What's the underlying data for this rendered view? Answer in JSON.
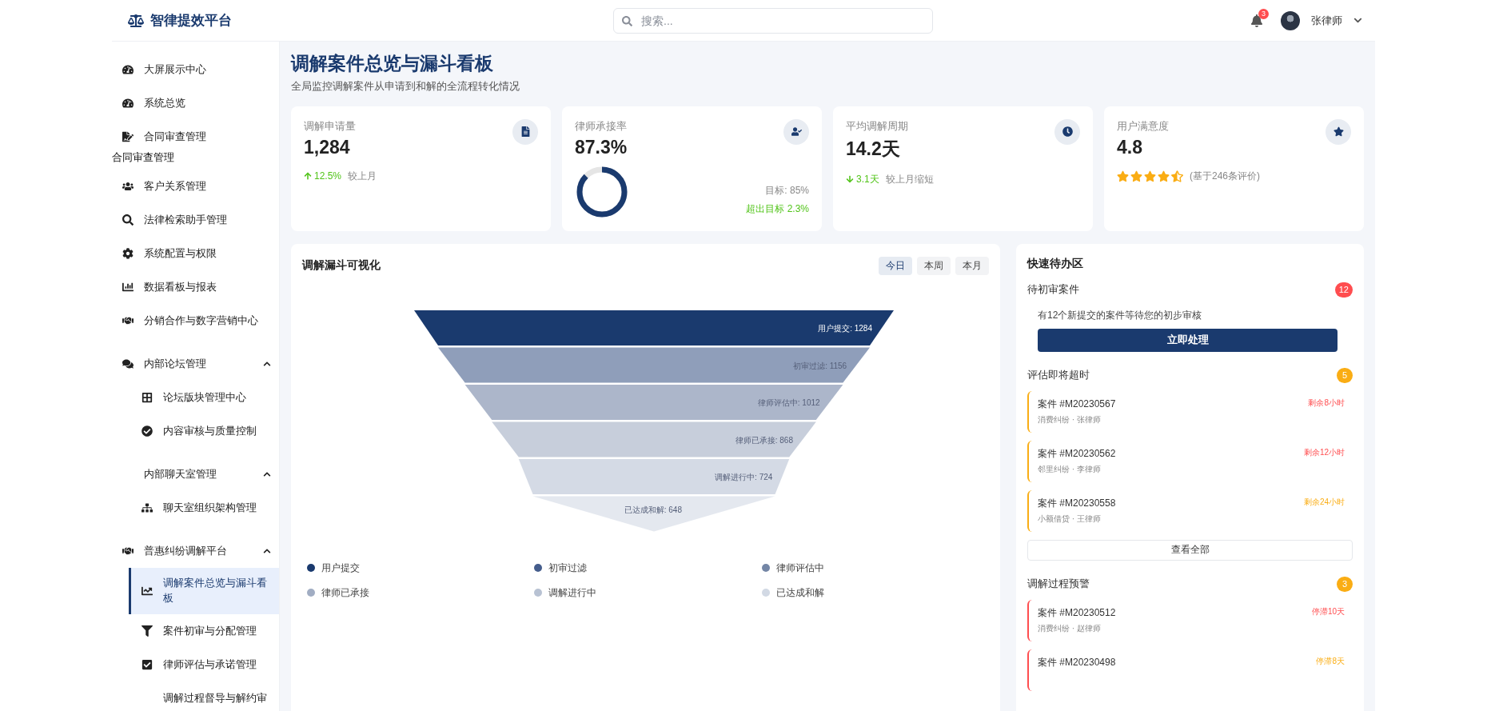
{
  "header": {
    "logo": "智律提效平台",
    "search": {
      "placeholder": "搜索..."
    },
    "notifications": "3",
    "user": "张律师"
  },
  "sidebar": {
    "items": [
      {
        "kind": "link",
        "label": "大屏展示中心",
        "selected": false
      },
      {
        "kind": "link",
        "label": "系统总览",
        "selected": false
      },
      {
        "kind": "link",
        "label": "合同审查管理",
        "selected": false
      },
      {
        "kind": "label",
        "label": "合同审查管理"
      },
      {
        "kind": "link",
        "label": "客户关系管理",
        "selected": false
      },
      {
        "kind": "link",
        "label": "法律检索助手管理",
        "selected": false
      },
      {
        "kind": "link",
        "label": "系统配置与权限",
        "selected": false
      },
      {
        "kind": "link",
        "label": "数据看板与报表",
        "selected": false
      },
      {
        "kind": "link",
        "label": "分销合作与数字营销中心",
        "selected": false
      },
      {
        "kind": "group",
        "label": "内部论坛管理",
        "expanded": true,
        "children": [
          {
            "label": "论坛版块管理中心",
            "selected": false
          },
          {
            "label": "内容审核与质量控制",
            "selected": false
          }
        ]
      },
      {
        "kind": "group",
        "label": "内部聊天室管理",
        "expanded": true,
        "children": [
          {
            "label": "聊天室组织架构管理",
            "selected": false
          }
        ]
      },
      {
        "kind": "group",
        "label": "普惠纠纷调解平台",
        "expanded": true,
        "children": [
          {
            "label": "调解案件总览与漏斗看板",
            "selected": true
          },
          {
            "label": "案件初审与分配管理",
            "selected": false
          },
          {
            "label": "律师评估与承诺管理",
            "selected": false
          },
          {
            "label": "调解过程督导与解约审",
            "selected": false
          }
        ]
      }
    ]
  },
  "page": {
    "title": "调解案件总览与漏斗看板",
    "subtitle": "全局监控调解案件从申请到和解的全流程转化情况"
  },
  "stats": [
    {
      "kind": "trend",
      "label": "调解申请量",
      "value": "1,284",
      "rising": true,
      "change": "12.5%",
      "note": "较上月"
    },
    {
      "kind": "donut",
      "label": "律师承接率",
      "value": "87.3%",
      "level": 0.873,
      "target": "目标: 85%",
      "delta": "超出目标 2.3%"
    },
    {
      "kind": "trend",
      "label": "平均调解周期",
      "value": "14.2天",
      "rising": false,
      "change": "3.1天",
      "note": "较上月缩短"
    },
    {
      "kind": "rating",
      "label": "用户满意度",
      "value": "4.8",
      "stars": 4.5,
      "note": "(基于246条评价)"
    }
  ],
  "funnel": {
    "title": "调解漏斗可视化",
    "ranges": [
      {
        "label": "今日",
        "selected": true
      },
      {
        "label": "本周",
        "selected": false
      },
      {
        "label": "本月",
        "selected": false
      }
    ],
    "stages": [
      {
        "label": "用户提交: 1284"
      },
      {
        "label": "初审过滤: 1156"
      },
      {
        "label": "律师评估中: 1012"
      },
      {
        "label": "律师已承接: 868"
      },
      {
        "label": "调解进行中: 724"
      },
      {
        "label": "已达成和解: 648"
      }
    ],
    "legend": [
      {
        "label": "用户提交",
        "color": "#1a3a6e"
      },
      {
        "label": "初审过滤",
        "color": "#455d8c"
      },
      {
        "label": "律师评估中",
        "color": "#7486a6"
      },
      {
        "label": "律师已承接",
        "color": "#a1adc3"
      },
      {
        "label": "调解进行中",
        "color": "#b8c2d3"
      },
      {
        "label": "已达成和解",
        "color": "#d2d9e4"
      }
    ]
  },
  "todo": {
    "title": "快速待办区",
    "sections": [
      {
        "kind": "notice",
        "title": "待初审案件",
        "count": "12",
        "color": "#ff4d4f",
        "message": "有12个新提交的案件等待您的初步审核",
        "action": "立即处理"
      },
      {
        "kind": "list",
        "title": "评估即将超时",
        "count": "5",
        "color": "#faad14",
        "items": [
          {
            "case": "案件 #M20230567",
            "meta": "消费纠纷 · 张律师",
            "due": "剩余8小时",
            "urgent": true,
            "color": "#faad14"
          },
          {
            "case": "案件 #M20230562",
            "meta": "邻里纠纷 · 李律师",
            "due": "剩余12小时",
            "urgent": true,
            "color": "#faad14"
          },
          {
            "case": "案件 #M20230558",
            "meta": "小额借贷 · 王律师",
            "due": "剩余24小时",
            "urgent": false,
            "color": "#faad14"
          }
        ],
        "more": "查看全部"
      },
      {
        "kind": "list",
        "title": "调解过程预警",
        "count": "3",
        "color": "#faad14",
        "items": [
          {
            "case": "案件 #M20230512",
            "meta": "消费纠纷 · 赵律师",
            "due": "停滞10天",
            "urgent": true,
            "color": "#ff4d4f"
          },
          {
            "case": "案件 #M20230498",
            "due": "停滞8天",
            "urgent": false,
            "color": "#ff4d4f"
          }
        ]
      }
    ]
  }
}
